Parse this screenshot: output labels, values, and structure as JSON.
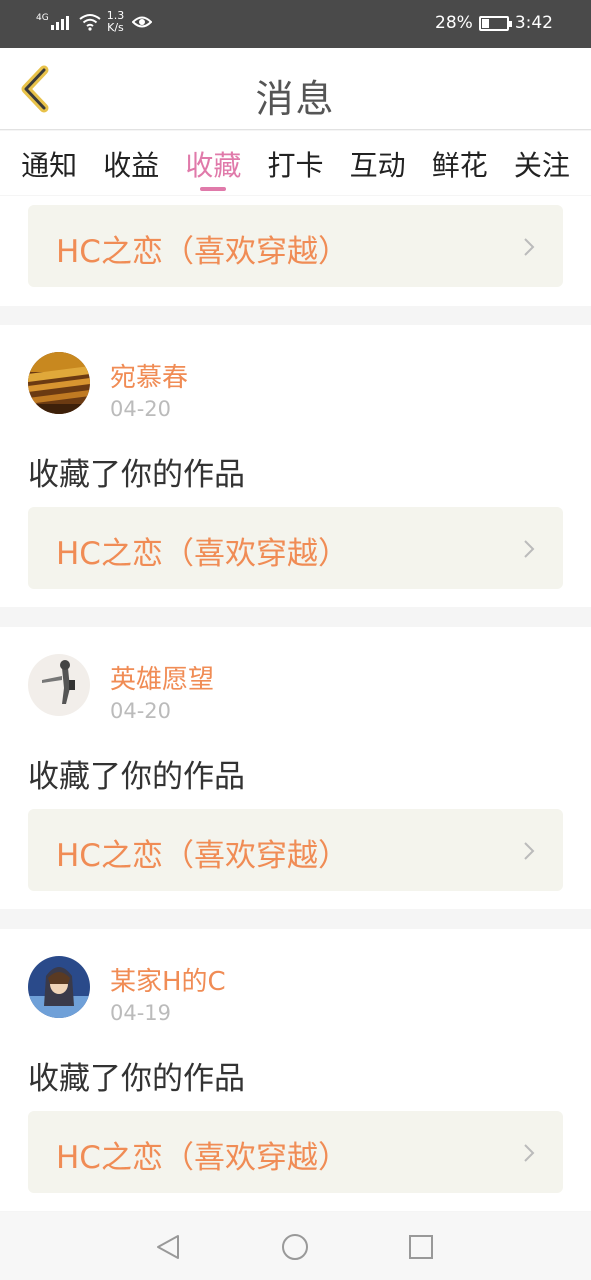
{
  "status_bar": {
    "network": "4G",
    "speed_value": "1.3",
    "speed_unit": "K/s",
    "battery": "28%",
    "battery_level": 0.28,
    "time": "3:42"
  },
  "header": {
    "title": "消息",
    "back_icon": "chevron-left-icon"
  },
  "tabs": [
    {
      "label": "通知",
      "active": false
    },
    {
      "label": "收益",
      "active": false
    },
    {
      "label": "收藏",
      "active": true
    },
    {
      "label": "打卡",
      "active": false
    },
    {
      "label": "互动",
      "active": false
    },
    {
      "label": "鲜花",
      "active": false
    },
    {
      "label": "关注",
      "active": false
    }
  ],
  "top_card": {
    "work_title": "HC之恋（喜欢穿越）"
  },
  "notifications": [
    {
      "user": "宛慕春",
      "date": "04-20",
      "action": "收藏了你的作品",
      "work_title": "HC之恋（喜欢穿越）"
    },
    {
      "user": "英雄愿望",
      "date": "04-20",
      "action": "收藏了你的作品",
      "work_title": "HC之恋（喜欢穿越）"
    },
    {
      "user": "某家H的C",
      "date": "04-19",
      "action": "收藏了你的作品",
      "work_title": "HC之恋（喜欢穿越）"
    }
  ],
  "colors": {
    "accent_pink": "#e07aaa",
    "orange_text": "#f08c55",
    "status_bar": "#4a4a4a"
  },
  "nav_bar": {
    "back": "triangle-back-icon",
    "home": "circle-home-icon",
    "recents": "square-recents-icon"
  }
}
